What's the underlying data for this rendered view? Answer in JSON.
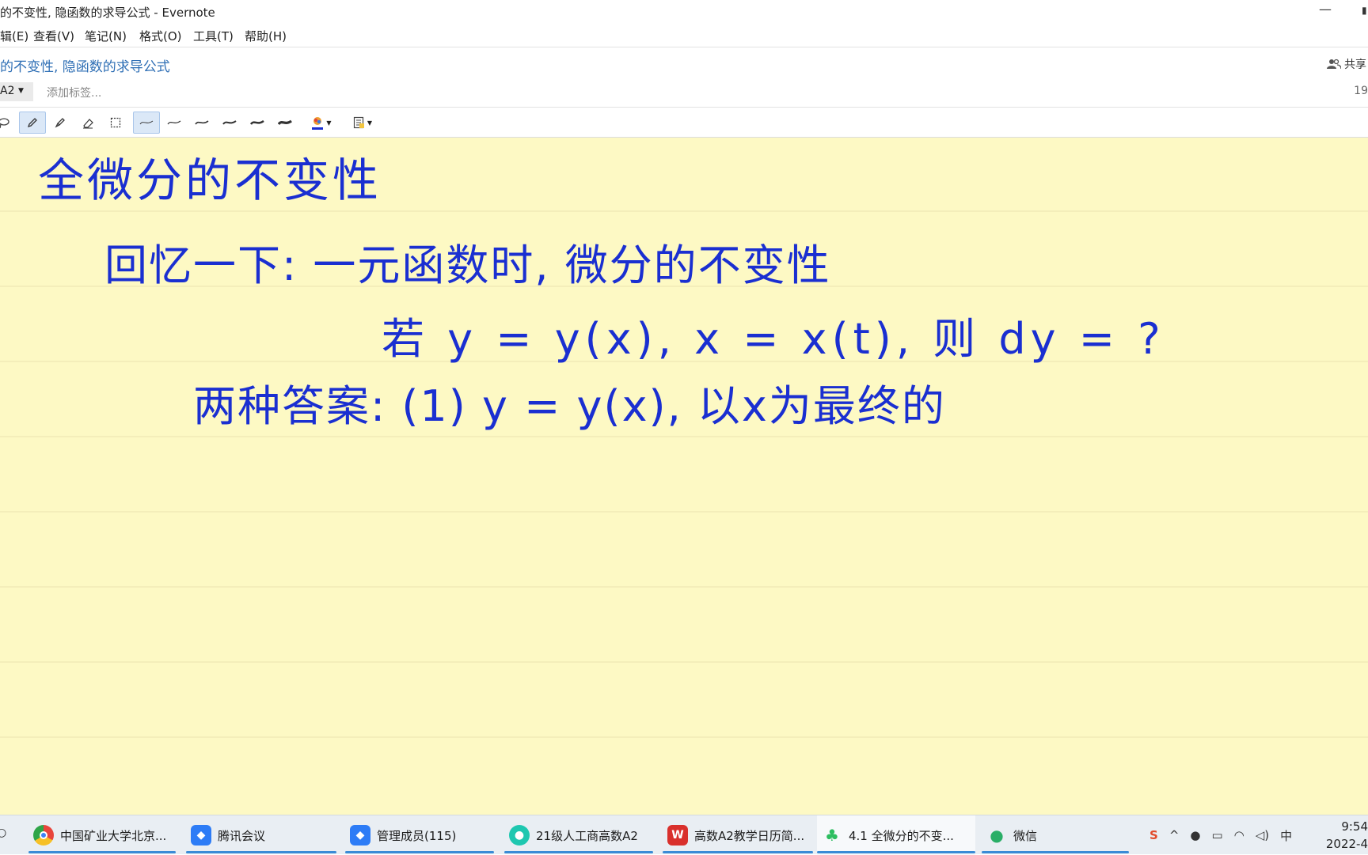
{
  "window": {
    "title": "的不变性, 隐函数的求导公式 - Evernote",
    "minimize_glyph": "—",
    "right_glyph": "▮"
  },
  "menu": [
    "辑(E)",
    "查看(V)",
    "笔记(N)",
    "格式(O)",
    "工具(T)",
    "帮助(H)"
  ],
  "note": {
    "title": "的不变性, 隐函数的求导公式",
    "share_label": "共享",
    "notebook_label": "A2",
    "tag_placeholder": "添加标签...",
    "right_number": "19"
  },
  "toolbar": {
    "tools": [
      "lasso-icon",
      "pen-icon",
      "highlighter-icon",
      "eraser-icon",
      "selection-icon"
    ],
    "active_tool": "pen-icon",
    "stroke_widths": [
      "thin",
      "thin-2",
      "medium",
      "medium-2",
      "thick",
      "thickest"
    ],
    "active_stroke": "thin",
    "ink_color": "#1a2fd1"
  },
  "handwriting": {
    "line1": "全微分的不变性",
    "line2": "回忆一下: 一元函数时, 微分的不变性",
    "line3": "若 y = y(x), x = x(t), 则 dy = ?",
    "line4": "两种答案: (1) y = y(x), 以x为最终的"
  },
  "taskbar": {
    "items": [
      {
        "label": "中国矿业大学北京...",
        "icon": "chrome-icon",
        "color": "#e8453c"
      },
      {
        "label": "腾讯会议",
        "icon": "tencent-meeting-icon",
        "color": "#2d7cf6"
      },
      {
        "label": "管理成员(115)",
        "icon": "tencent-meeting-icon",
        "color": "#2d7cf6"
      },
      {
        "label": "21级人工商高数A2",
        "icon": "bulb-icon",
        "color": "#1ec7b0"
      },
      {
        "label": "高数A2教学日历简...",
        "icon": "wps-icon",
        "color": "#d9302c"
      },
      {
        "label": "4.1 全微分的不变...",
        "icon": "evernote-icon",
        "color": "#2dbe60"
      },
      {
        "label": "微信",
        "icon": "wechat-icon",
        "color": "#2aae67"
      }
    ],
    "active_index": 5,
    "ime": "中",
    "time": "9:54",
    "date": "2022-4"
  }
}
